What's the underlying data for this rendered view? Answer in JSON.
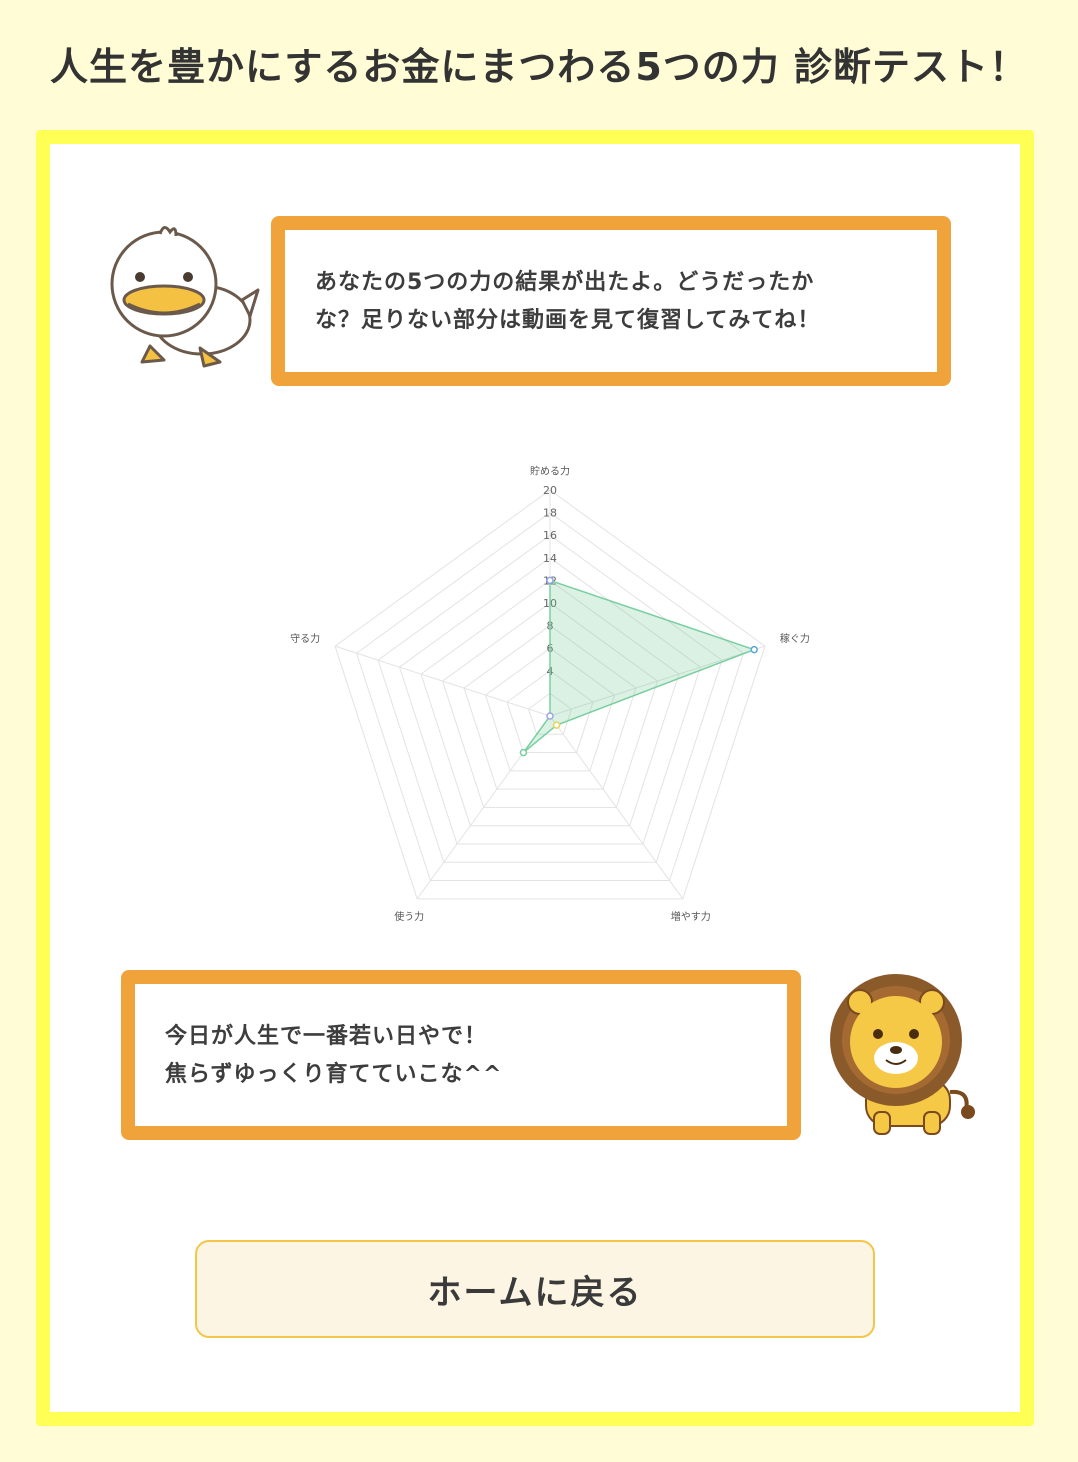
{
  "page": {
    "title": "人生を豊かにするお金にまつわる5つの力 診断テスト！"
  },
  "result_message": {
    "line1": "あなたの5つの力の結果が出たよ。どうだったか",
    "line2": "な？足りない部分は動画を見て復習してみてね！"
  },
  "advice_message": {
    "line1": "今日が人生で一番若い日やで！",
    "line2": "焦らずゆっくり育てていこな^^"
  },
  "home_button": {
    "label": "ホームに戻る"
  },
  "icons": {
    "mascot_duck": "duck-mascot-icon",
    "mascot_lion": "lion-mascot-icon"
  },
  "colors": {
    "background": "#fffcd6",
    "card_border": "#ffff55",
    "bubble_border": "#f0a33a",
    "series_fill": "rgba(108,200,148,0.25)",
    "series_line": "#79cfa0"
  },
  "chart_data": {
    "type": "radar",
    "categories": [
      "貯める力",
      "稼ぐ力",
      "増やす力",
      "使う力",
      "守る力"
    ],
    "series": [
      {
        "values": [
          12,
          19,
          1,
          4,
          0
        ]
      }
    ],
    "r_range": [
      0,
      20
    ],
    "r_ticks": [
      "4",
      "6",
      "8",
      "10",
      "12",
      "14",
      "16",
      "18",
      "20"
    ],
    "grid": true,
    "legend": "none"
  }
}
